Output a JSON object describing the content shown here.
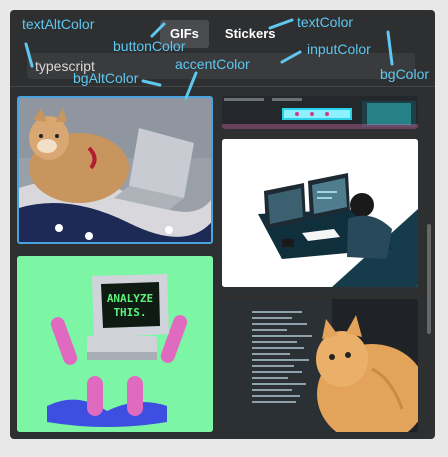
{
  "tabs": [
    {
      "label": "GIFs",
      "active": true
    },
    {
      "label": "Stickers",
      "active": false
    }
  ],
  "search": {
    "value": "typescript"
  },
  "annotations": {
    "text_alt_color": "textAltColor",
    "button_color": "buttonColor",
    "text_color": "textColor",
    "input_color": "inputColor",
    "bg_color": "bgColor",
    "bg_alt_color": "bgAltColor",
    "accent_color": "accentColor"
  },
  "gif_content": {
    "analyze_line1": "ANALYZE",
    "analyze_line2": "THIS."
  },
  "colors": {
    "background": "#2e2f31",
    "accent": "#4aa3df",
    "annotation": "#5ec8f0",
    "sticker_bg": "#7cf5a5"
  }
}
